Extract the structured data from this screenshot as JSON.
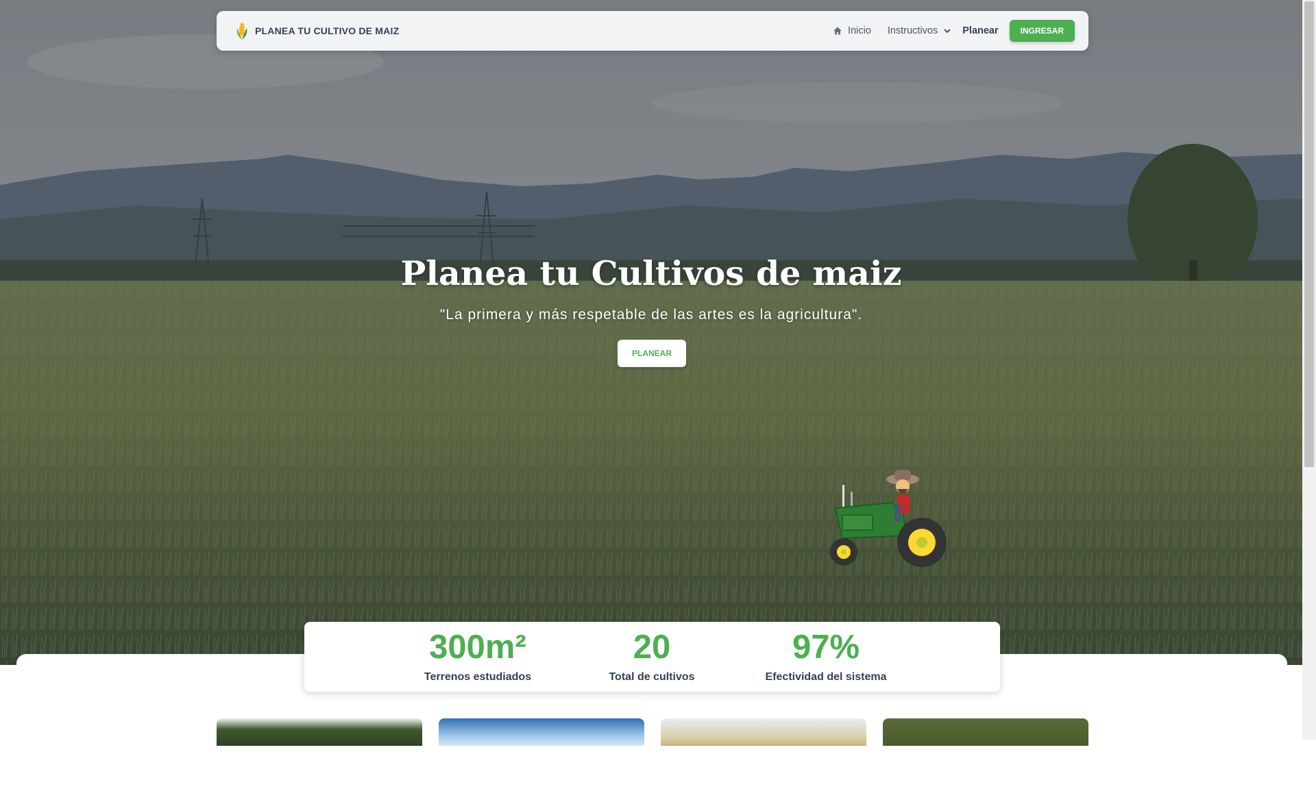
{
  "navbar": {
    "brand": "PLANEA TU CULTIVO DE MAIZ",
    "links": {
      "home": "Inicio",
      "instructivos": "Instructivos",
      "planear": "Planear"
    },
    "login_button": "INGRESAR"
  },
  "hero": {
    "title": "Planea tu Cultivos de maiz",
    "quote": "\"La primera y más respetable de las artes es la agricultura\".",
    "button": "PLANEAR"
  },
  "stats": [
    {
      "value": "300m²",
      "label": "Terrenos estudiados"
    },
    {
      "value": "20",
      "label": "Total de cultivos"
    },
    {
      "value": "97%",
      "label": "Efectividad del sistema"
    }
  ],
  "colors": {
    "accent": "#4caf50",
    "text_dark": "#344054"
  },
  "icons": [
    "corn-icon",
    "home-icon",
    "chevron-down-icon",
    "tractor-icon"
  ]
}
